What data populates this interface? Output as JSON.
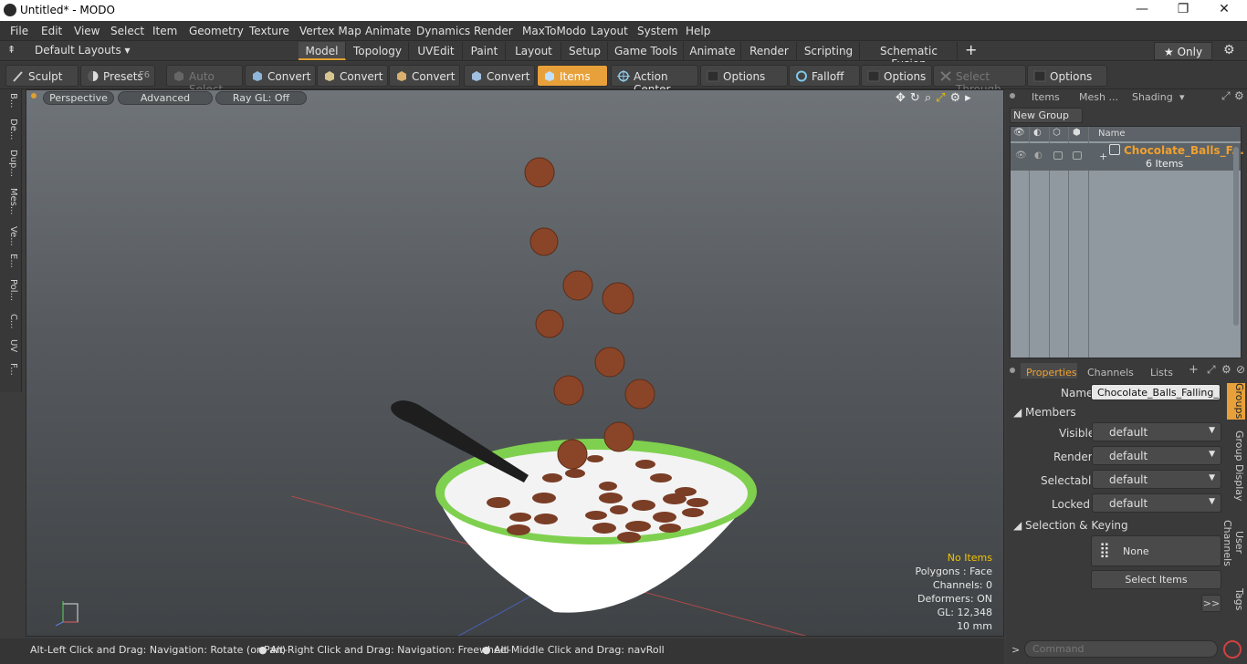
{
  "window": {
    "title": "Untitled* - MODO",
    "minimize": "—",
    "restore": "❐",
    "close": "✕"
  },
  "menu": [
    "File",
    "Edit",
    "View",
    "Select",
    "Item",
    "Geometry",
    "Texture",
    "Vertex Map",
    "Animate",
    "Dynamics",
    "Render",
    "MaxToModo",
    "Layout",
    "System",
    "Help"
  ],
  "layouts": {
    "selector": "Default Layouts ▾",
    "tabs": [
      "Model",
      "Topology",
      "UVEdit",
      "Paint",
      "Layout",
      "Setup",
      "Game Tools",
      "Animate",
      "Render",
      "Scripting",
      "Schematic Fusion"
    ],
    "add": "+",
    "only": "★ Only"
  },
  "toolbar": {
    "sculpt": "Sculpt",
    "presets": "Presets",
    "presets_key": "F6",
    "auto_select": "Auto Select",
    "convert": "Convert",
    "items": "Items",
    "action_center": "Action Center",
    "options": "Options",
    "falloff": "Falloff",
    "select_through": "Select Through"
  },
  "left_tabs": [
    "B...",
    "De...",
    "Dup...",
    "Mes...",
    "Ve...",
    "E...",
    "Pol...",
    "C...",
    "UV",
    "F..."
  ],
  "viewport": {
    "view": "Perspective",
    "advanced": "Advanced",
    "raygl": "Ray GL: Off",
    "info": {
      "no_items": "No Items",
      "polygons": "Polygons : Face",
      "channels": "Channels: 0",
      "deformers": "Deformers: ON",
      "gl": "GL: 12,348",
      "scale": "10 mm"
    }
  },
  "status": {
    "hint1": "Alt-Left Click and Drag: Navigation: Rotate (or Pan)",
    "hint2": "Alt-Right Click and Drag: Navigation: Freewheel",
    "hint3": "Alt-Middle Click and Drag: navRoll"
  },
  "items_panel": {
    "tabs": [
      "Items",
      "Mesh ...",
      "Shading"
    ],
    "new_group": "New Group",
    "col_name": "Name",
    "group_name": "Chocolate_Balls_F...",
    "group_count": "6 Items"
  },
  "properties": {
    "tabs": [
      "Properties",
      "Channels",
      "Lists"
    ],
    "name_label": "Name",
    "name_value": "Chocolate_Balls_Falling_into",
    "members": "Members",
    "visible": "Visible",
    "render": "Render",
    "selectable": "Selectable",
    "locked": "Locked",
    "default": "default",
    "selection_keying": "Selection & Keying",
    "none": "None",
    "select_items": "Select Items",
    "more": ">>"
  },
  "right_vtabs": [
    "Groups",
    "Group Display",
    "User Channels",
    "Tags"
  ],
  "command": {
    "placeholder": "Command",
    "prompt": ">"
  }
}
